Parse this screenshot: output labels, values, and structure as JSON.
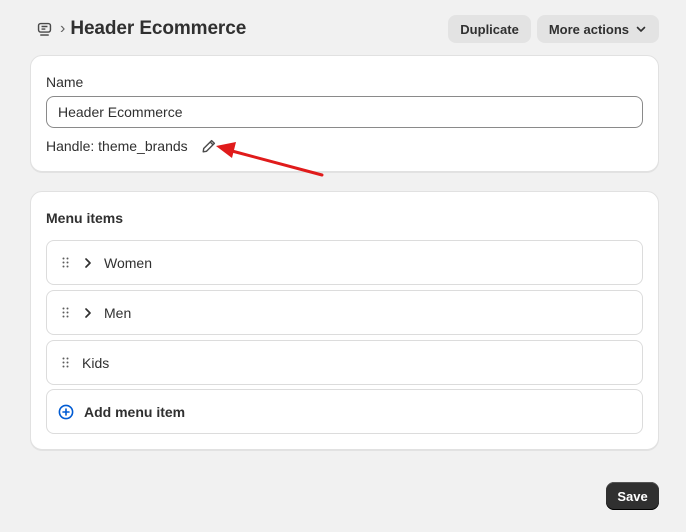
{
  "header": {
    "title": "Header Ecommerce",
    "nav_icon": "menu-nav-icon",
    "separator": "›",
    "actions": {
      "duplicate_label": "Duplicate",
      "more_actions_label": "More actions"
    }
  },
  "details": {
    "name_label": "Name",
    "name_value": "Header Ecommerce",
    "handle_text": "Handle: theme_brands",
    "edit_icon": "pencil-icon"
  },
  "menu": {
    "title": "Menu items",
    "items": [
      {
        "label": "Women",
        "expandable": true
      },
      {
        "label": "Men",
        "expandable": true
      },
      {
        "label": "Kids",
        "expandable": false
      }
    ],
    "add_label": "Add menu item"
  },
  "footer": {
    "save_label": "Save"
  },
  "colors": {
    "background": "#f1f1f1",
    "card": "#ffffff",
    "primary_button": "#303030",
    "annotation_arrow": "#e01b1b",
    "add_icon": "#005bd3"
  }
}
